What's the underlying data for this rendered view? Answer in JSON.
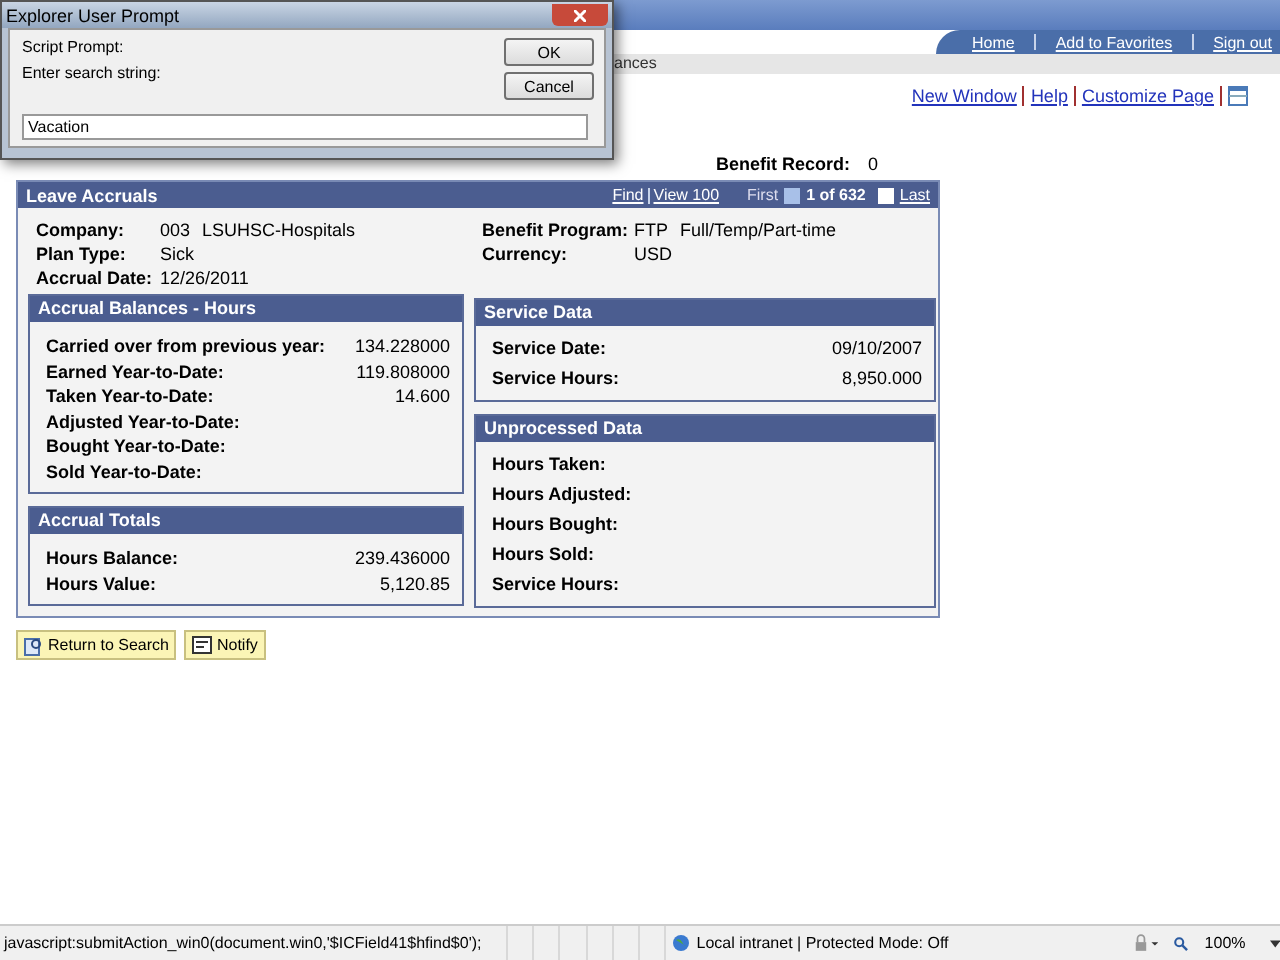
{
  "dialog": {
    "title": "Explorer User Prompt",
    "prompt_label": "Script Prompt:",
    "message": "Enter search string:",
    "value": "Vacation",
    "buttons": [
      "OK",
      "Cancel"
    ]
  },
  "header_links": [
    "Home",
    "Add to Favorites",
    "Sign out"
  ],
  "breadcrumb_fragment": "ances",
  "page_links": [
    "New Window",
    "Help",
    "Customize Page"
  ],
  "benefit_record": {
    "label": "Benefit Record:",
    "value": "0"
  },
  "panel": {
    "title": "Leave Accruals",
    "nav": {
      "find": "Find",
      "view": "View 100",
      "first": "First",
      "position": "1 of 632",
      "last": "Last"
    },
    "fields_left": [
      {
        "label": "Company:",
        "values": [
          "003",
          "LSUHSC-Hospitals"
        ]
      },
      {
        "label": "Plan Type:",
        "values": [
          "Sick"
        ]
      },
      {
        "label": "Accrual Date:",
        "values": [
          "12/26/2011"
        ]
      }
    ],
    "fields_right": [
      {
        "label": "Benefit Program:",
        "values": [
          "FTP",
          "Full/Temp/Part-time"
        ]
      },
      {
        "label": "Currency:",
        "values": [
          "USD"
        ]
      }
    ],
    "left_sections": [
      {
        "title": "Accrual Balances - Hours",
        "rows": [
          {
            "label": "Carried over from previous year:",
            "value": "134.228000"
          },
          {
            "label": "Earned Year-to-Date:",
            "value": "119.808000"
          },
          {
            "label": "Taken Year-to-Date:",
            "value": "14.600"
          },
          {
            "label": "Adjusted Year-to-Date:"
          },
          {
            "label": "Bought Year-to-Date:"
          },
          {
            "label": "Sold Year-to-Date:"
          }
        ]
      },
      {
        "title": "Accrual Totals",
        "rows": [
          {
            "label": "Hours Balance:",
            "value": "239.436000"
          },
          {
            "label": "Hours Value:",
            "value": "5,120.85"
          }
        ]
      }
    ],
    "right_sections": [
      {
        "title": "Service Data",
        "rows": [
          {
            "label": "Service Date:",
            "value": "09/10/2007"
          },
          {
            "label": "Service Hours:",
            "value": "8,950.000"
          }
        ]
      },
      {
        "title": "Unprocessed Data",
        "rows": [
          {
            "label": "Hours Taken:"
          },
          {
            "label": "Hours Adjusted:"
          },
          {
            "label": "Hours Bought:"
          },
          {
            "label": "Hours Sold:"
          },
          {
            "label": "Service Hours:"
          }
        ]
      }
    ]
  },
  "buttons": [
    {
      "kind": "search",
      "label": "Return to Search"
    },
    {
      "kind": "notify",
      "label": "Notify"
    }
  ],
  "status_bar": {
    "url": "javascript:submitAction_win0(document.win0,'$ICField41$hfind$0');",
    "zone": "Local intranet | Protected Mode: Off",
    "zoom": "100%"
  }
}
